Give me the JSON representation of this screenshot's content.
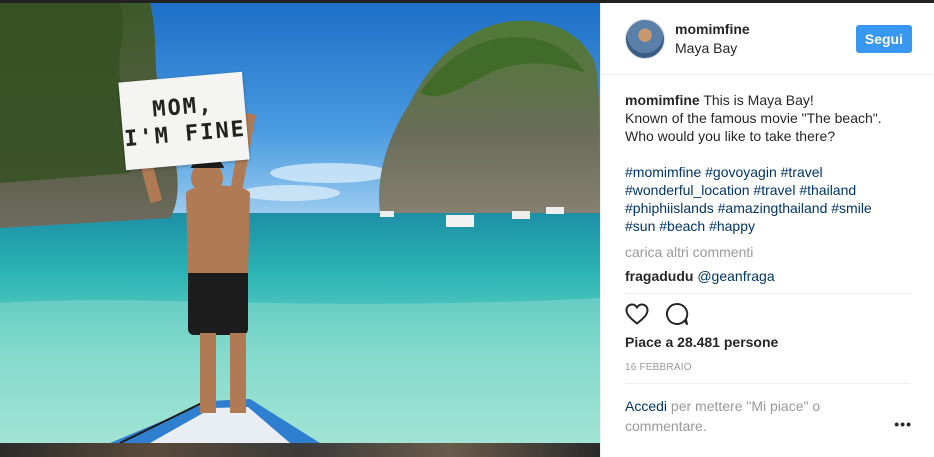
{
  "post": {
    "sign_line1": "MOM,",
    "sign_line2": "I'M FINE"
  },
  "header": {
    "username": "momimfine",
    "location": "Maya Bay",
    "follow_label": "Segui"
  },
  "caption": {
    "username": "momimfine",
    "text_line1": " This is Maya Bay!",
    "text_line2": "Known of the famous movie \"The beach\".",
    "text_line3": "Who would you like to take there?",
    "hashtags_line1": "#momimfine #govoyagin #travel",
    "hashtags_line2": "#wonderful_location #travel #thailand",
    "hashtags_line3": "#phiphiislands #amazingthailand #smile",
    "hashtags_line4": "#sun #beach #happy"
  },
  "load_more": "carica altri commenti",
  "comment": {
    "username": "fragadudu",
    "mention": "@geanfraga"
  },
  "likes": "Piace a 28.481 persone",
  "date": "16 FEBBRAIO",
  "footer": {
    "login_link": "Accedi",
    "text1": " per mettere \"Mi piace\" o",
    "text2": "commentare.",
    "more": "•••"
  },
  "icons": {
    "like": "heart-outline-icon",
    "comment": "speech-bubble-icon",
    "more": "more-options-icon"
  },
  "colors": {
    "accent": "#3897f0",
    "link": "#003569",
    "muted": "#999999"
  }
}
